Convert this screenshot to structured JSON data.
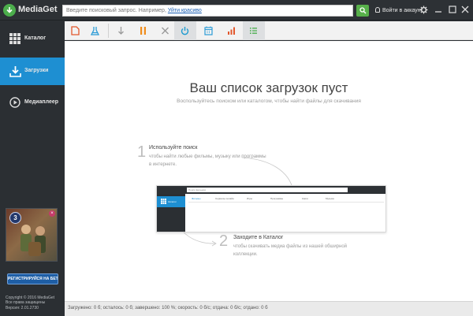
{
  "app": {
    "title": "MediaGet"
  },
  "search": {
    "placeholder": "Введите поисковый запрос. Например, ",
    "example_link": "Уйти красиво"
  },
  "header": {
    "login_label": "Войти в аккаунт"
  },
  "sidebar": {
    "items": [
      {
        "label": "Каталог",
        "icon": "grid-icon"
      },
      {
        "label": "Загрузки",
        "icon": "download-icon",
        "active": true
      },
      {
        "label": "Медиаплеер",
        "icon": "play-icon"
      }
    ],
    "promo": {
      "level": "3",
      "close": "×",
      "button_label": "РЕГИСТРИРУЙСЯ НА БЕТУ"
    },
    "copyright": [
      "Copyright © 2016 MediaGet",
      "Все права защищены",
      "Версия: 2.01.2730"
    ]
  },
  "toolbar": {
    "buttons": [
      {
        "icon": "document-icon",
        "color": "#e2572c"
      },
      {
        "icon": "flask-icon",
        "color": "#2b9bd6"
      },
      {
        "icon": "arrow-down-icon",
        "color": "#9a9a9a"
      },
      {
        "icon": "pause-icon",
        "color": "#f08c1a"
      },
      {
        "icon": "close-icon",
        "color": "#9a9a9a"
      },
      {
        "icon": "power-icon",
        "color": "#1e9bd0"
      },
      {
        "icon": "calendar-icon",
        "color": "#2b9bd6"
      },
      {
        "icon": "bar-chart-icon",
        "color": "#e2572c"
      },
      {
        "icon": "list-icon",
        "color": "#4caf50"
      }
    ]
  },
  "main": {
    "empty_title": "Ваш список загрузок пуст",
    "empty_subtitle": "Воспользуйтесь поиском или каталогом, чтобы найти файлы для скачивания",
    "step1": {
      "num": "1",
      "title": "Используйте поиск",
      "text": "чтобы найти любые фильмы, музыку или программы в интернете."
    },
    "step2": {
      "num": "2",
      "title": "Заходите в Каталог",
      "text": "чтобы скачивать медиа файлы из нашей обширной коллекции."
    },
    "mini_preview": {
      "search_placeholder": "Поиск фильмов",
      "sidebar_label": "Каталог",
      "tabs": [
        "Фильмы",
        "Сериалы онлайн",
        "Игры",
        "Программы",
        "Книги",
        "Музыка"
      ]
    }
  },
  "status": {
    "text": "Загружено: 0 б; осталось: 0 б; завершено: 100 %; скорость: 0 б/с; отдача: 0 б/с; отдано: 0 б"
  }
}
